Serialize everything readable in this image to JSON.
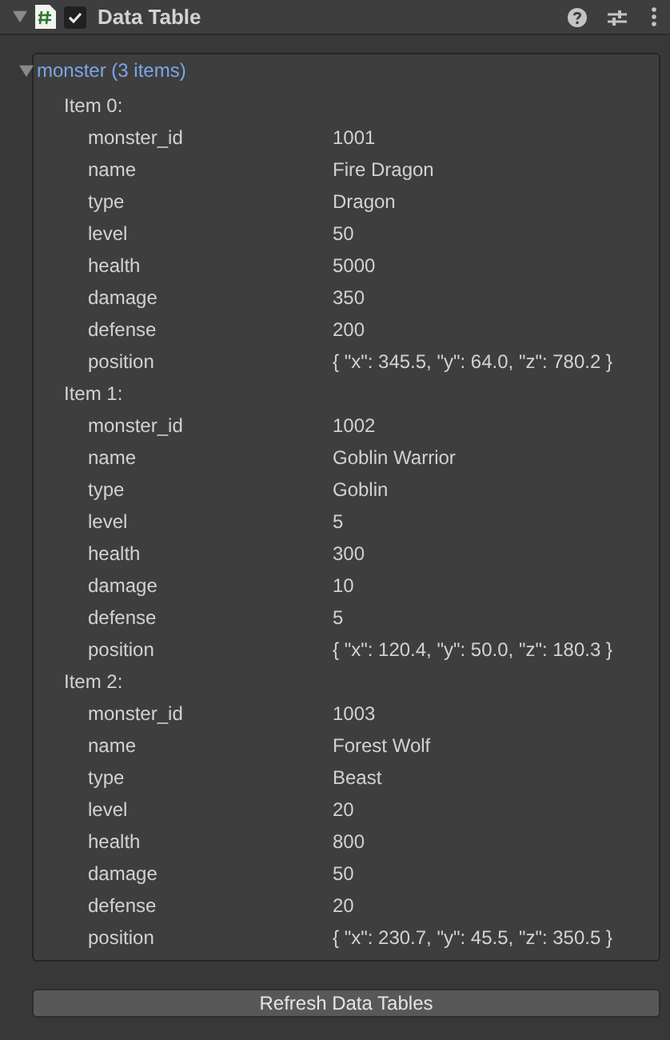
{
  "component": {
    "title": "Data Table",
    "enabled": true,
    "expanded": true
  },
  "list": {
    "label": "monster (3 items)",
    "expanded": true,
    "items": [
      {
        "label": "Item 0:",
        "fields": [
          {
            "name": "monster_id",
            "value": "1001"
          },
          {
            "name": "name",
            "value": "Fire Dragon"
          },
          {
            "name": "type",
            "value": "Dragon"
          },
          {
            "name": "level",
            "value": "50"
          },
          {
            "name": "health",
            "value": "5000"
          },
          {
            "name": "damage",
            "value": "350"
          },
          {
            "name": "defense",
            "value": "200"
          },
          {
            "name": "position",
            "value": "{ \"x\": 345.5, \"y\": 64.0, \"z\": 780.2 }"
          }
        ]
      },
      {
        "label": "Item 1:",
        "fields": [
          {
            "name": "monster_id",
            "value": "1002"
          },
          {
            "name": "name",
            "value": "Goblin Warrior"
          },
          {
            "name": "type",
            "value": "Goblin"
          },
          {
            "name": "level",
            "value": "5"
          },
          {
            "name": "health",
            "value": "300"
          },
          {
            "name": "damage",
            "value": "10"
          },
          {
            "name": "defense",
            "value": "5"
          },
          {
            "name": "position",
            "value": "{ \"x\": 120.4, \"y\": 50.0, \"z\": 180.3 }"
          }
        ]
      },
      {
        "label": "Item 2:",
        "fields": [
          {
            "name": "monster_id",
            "value": "1003"
          },
          {
            "name": "name",
            "value": "Forest Wolf"
          },
          {
            "name": "type",
            "value": "Beast"
          },
          {
            "name": "level",
            "value": "20"
          },
          {
            "name": "health",
            "value": "800"
          },
          {
            "name": "damage",
            "value": "50"
          },
          {
            "name": "defense",
            "value": "20"
          },
          {
            "name": "position",
            "value": "{ \"x\": 230.7, \"y\": 45.5, \"z\": 350.5 }"
          }
        ]
      }
    ]
  },
  "button": "Refresh Data Tables"
}
